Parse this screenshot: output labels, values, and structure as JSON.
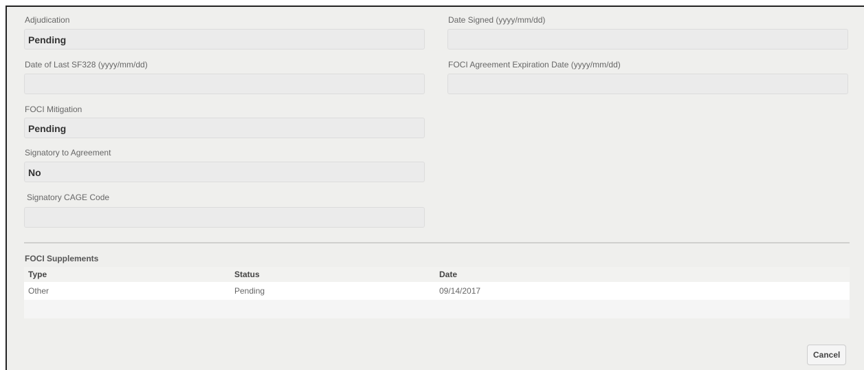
{
  "form": {
    "adjudication": {
      "label": "Adjudication",
      "value": "Pending"
    },
    "date_signed": {
      "label": "Date Signed (yyyy/mm/dd)",
      "value": ""
    },
    "date_last_sf328": {
      "label": "Date of Last SF328 (yyyy/mm/dd)",
      "value": ""
    },
    "foci_expiration": {
      "label": "FOCI Agreement Expiration Date (yyyy/mm/dd)",
      "value": ""
    },
    "foci_mitigation": {
      "label": "FOCI Mitigation",
      "value": "Pending"
    },
    "signatory": {
      "label": "Signatory to Agreement",
      "value": "No"
    },
    "signatory_cage": {
      "label": "Signatory CAGE Code",
      "value": ""
    }
  },
  "supplements": {
    "title": "FOCI Supplements",
    "columns": [
      "Type",
      "Status",
      "Date"
    ],
    "rows": [
      [
        "Other",
        "Pending",
        "09/14/2017"
      ]
    ]
  },
  "actions": {
    "cancel_label": "Cancel"
  }
}
